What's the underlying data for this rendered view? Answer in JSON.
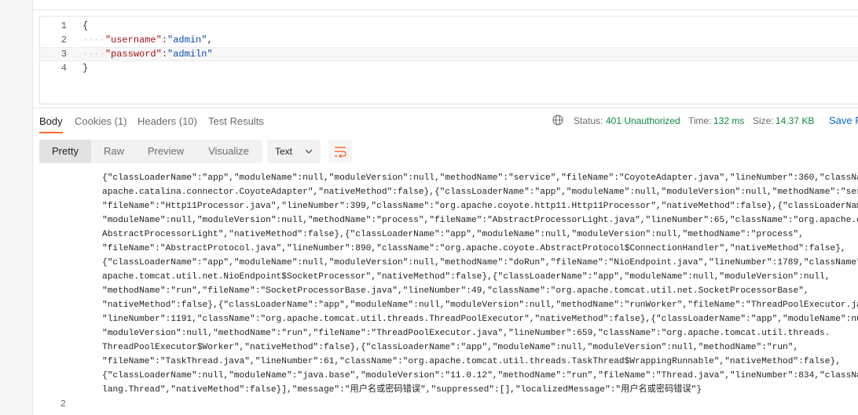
{
  "request": {
    "line_numbers": [
      "1",
      "2",
      "3",
      "4"
    ],
    "lines": {
      "l1": "{",
      "l2_key": "\"username\"",
      "l2_sep": ":",
      "l2_val": "\"admin\"",
      "l2_end": ",",
      "l3_key": "\"password\"",
      "l3_sep": ":",
      "l3_val": "\"admiln\"",
      "l4": "}",
      "indent": "····"
    }
  },
  "response_tabs": [
    {
      "label": "Body"
    },
    {
      "label": "Cookies (1)"
    },
    {
      "label": "Headers (10)"
    },
    {
      "label": "Test Results"
    }
  ],
  "status": {
    "status_label": "Status:",
    "status_value": "401 Unauthorized",
    "time_label": "Time:",
    "time_value": "132 ms",
    "size_label": "Size:",
    "size_value": "14.37 KB",
    "save_label": "Save R"
  },
  "view_modes": [
    "Pretty",
    "Raw",
    "Preview",
    "Visualize"
  ],
  "format_select": {
    "value": "Text"
  },
  "icons": {
    "globe": "globe-icon",
    "wrap": "wrap-lines-icon",
    "chevron": "chevron-down-icon"
  },
  "colors": {
    "accent": "#ff6c37",
    "status_401": "#0f8a3f",
    "link": "#0b6bcb"
  },
  "response_body": {
    "lines": [
      "{\"classLoaderName\":\"app\",\"moduleName\":null,\"moduleVersion\":null,\"methodName\":\"service\",\"fileName\":\"CoyoteAdapter.java\",\"lineNumber\":360,\"classNam",
      "apache.catalina.connector.CoyoteAdapter\",\"nativeMethod\":false},{\"classLoaderName\":\"app\",\"moduleName\":null,\"moduleVersion\":null,\"methodName\":\"servi",
      "\"fileName\":\"Http11Processor.java\",\"lineNumber\":399,\"className\":\"org.apache.coyote.http11.Http11Processor\",\"nativeMethod\":false},{\"classLoaderName\"",
      "\"moduleName\":null,\"moduleVersion\":null,\"methodName\":\"process\",\"fileName\":\"AbstractProcessorLight.java\",\"lineNumber\":65,\"className\":\"org.apache.coy",
      "AbstractProcessorLight\",\"nativeMethod\":false},{\"classLoaderName\":\"app\",\"moduleName\":null,\"moduleVersion\":null,\"methodName\":\"process\",",
      "\"fileName\":\"AbstractProtocol.java\",\"lineNumber\":890,\"className\":\"org.apache.coyote.AbstractProtocol$ConnectionHandler\",\"nativeMethod\":false},",
      "{\"classLoaderName\":\"app\",\"moduleName\":null,\"moduleVersion\":null,\"methodName\":\"doRun\",\"fileName\":\"NioEndpoint.java\",\"lineNumber\":1789,\"className\":\"",
      "apache.tomcat.util.net.NioEndpoint$SocketProcessor\",\"nativeMethod\":false},{\"classLoaderName\":\"app\",\"moduleName\":null,\"moduleVersion\":null,",
      "\"methodName\":\"run\",\"fileName\":\"SocketProcessorBase.java\",\"lineNumber\":49,\"className\":\"org.apache.tomcat.util.net.SocketProcessorBase\",",
      "\"nativeMethod\":false},{\"classLoaderName\":\"app\",\"moduleName\":null,\"moduleVersion\":null,\"methodName\":\"runWorker\",\"fileName\":\"ThreadPoolExecutor.java",
      "\"lineNumber\":1191,\"className\":\"org.apache.tomcat.util.threads.ThreadPoolExecutor\",\"nativeMethod\":false},{\"classLoaderName\":\"app\",\"moduleName\":null",
      "\"moduleVersion\":null,\"methodName\":\"run\",\"fileName\":\"ThreadPoolExecutor.java\",\"lineNumber\":659,\"className\":\"org.apache.tomcat.util.threads.",
      "ThreadPoolExecutor$Worker\",\"nativeMethod\":false},{\"classLoaderName\":\"app\",\"moduleName\":null,\"moduleVersion\":null,\"methodName\":\"run\",",
      "\"fileName\":\"TaskThread.java\",\"lineNumber\":61,\"className\":\"org.apache.tomcat.util.threads.TaskThread$WrappingRunnable\",\"nativeMethod\":false},",
      "{\"classLoaderName\":null,\"moduleName\":\"java.base\",\"moduleVersion\":\"11.0.12\",\"methodName\":\"run\",\"fileName\":\"Thread.java\",\"lineNumber\":834,\"classNam",
      "lang.Thread\",\"nativeMethod\":false}],\"message\":\"用户名或密码错误\",\"suppressed\":[],\"localizedMessage\":\"用户名或密码错误\"}"
    ],
    "next_line_number": "2"
  }
}
